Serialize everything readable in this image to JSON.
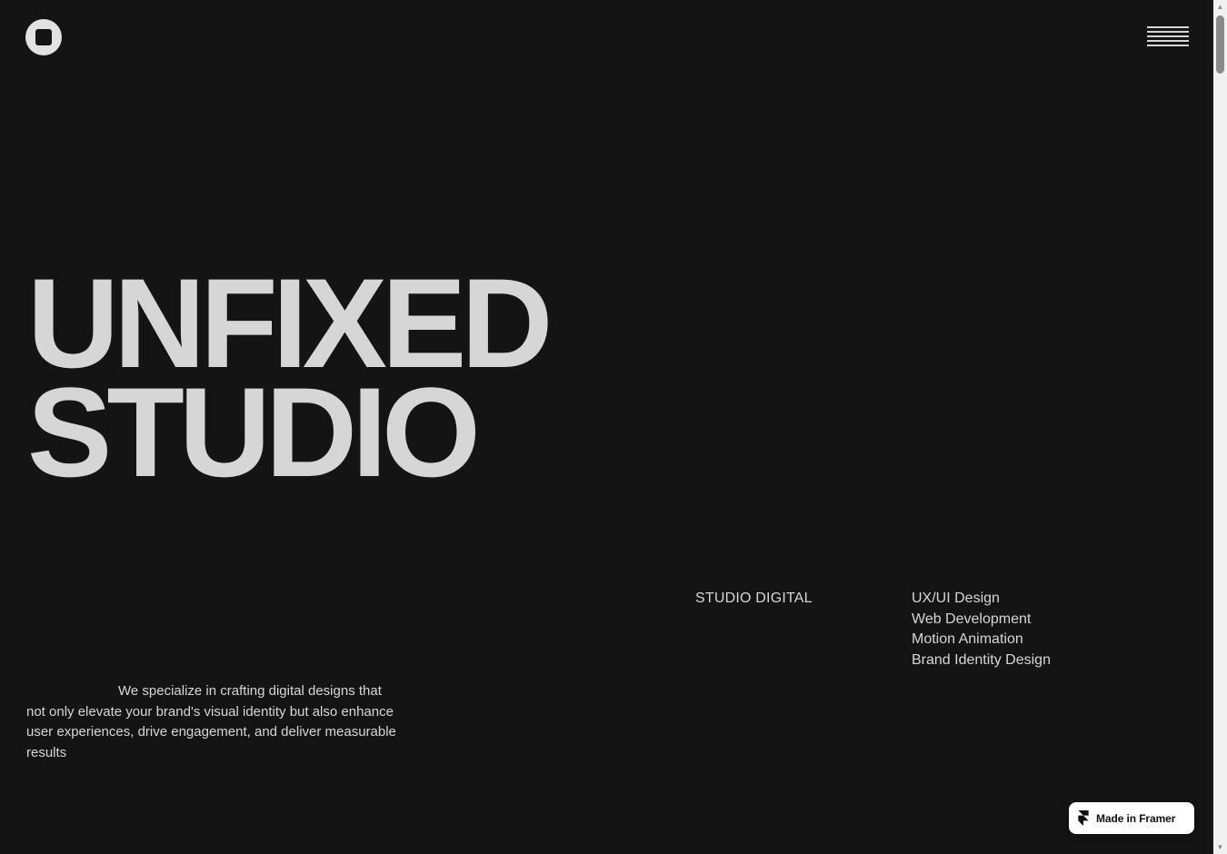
{
  "header": {
    "logo_icon": "circle-square-logo-icon",
    "menu_icon": "hamburger-menu-icon"
  },
  "hero": {
    "title_line1": "UNFIXED",
    "title_line2": "STUDIO"
  },
  "studio_label": "STUDIO DIGITAL",
  "services": [
    "UX/UI Design",
    "Web Development",
    "Motion Animation",
    "Brand Identity Design"
  ],
  "description": "We specialize in crafting digital designs that not only elevate your brand's visual identity but also enhance user experiences, drive engagement, and deliver measurable results",
  "badge": {
    "label": "Made in Framer",
    "icon": "framer-logo-icon"
  },
  "colors": {
    "background": "#141414",
    "text": "#d6d6d6",
    "badge_bg": "#ffffff"
  }
}
